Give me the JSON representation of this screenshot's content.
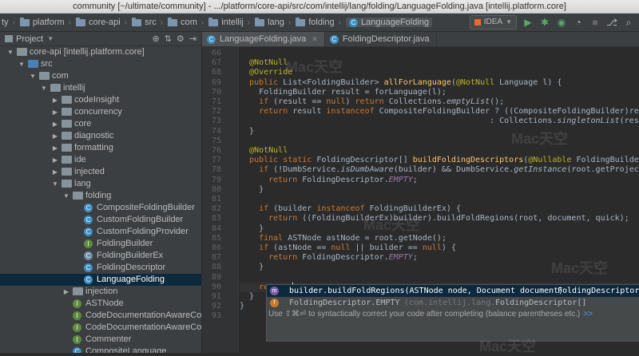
{
  "window": {
    "title": "community [~/ultimate/community] - .../platform/core-api/src/com/intellij/lang/folding/LanguageFolding.java [intellij.platform.core]"
  },
  "breadcrumbs": [
    {
      "label": "ty"
    },
    {
      "label": "platform"
    },
    {
      "label": "core-api"
    },
    {
      "label": "src"
    },
    {
      "label": "com"
    },
    {
      "label": "intellij"
    },
    {
      "label": "lang"
    },
    {
      "label": "folding"
    },
    {
      "label": "LanguageFolding"
    }
  ],
  "toolbar": {
    "run_config": "IDEA",
    "icons": [
      "run-icon",
      "debug-icon",
      "coverage-icon",
      "profile-icon",
      "stop-icon",
      "vcs-icon",
      "search-icon"
    ]
  },
  "project_panel": {
    "title": "Project",
    "tree": [
      {
        "label": "core-api [intellij.platform.core]",
        "depth": 0,
        "kind": "module",
        "expanded": true
      },
      {
        "label": "src",
        "depth": 1,
        "kind": "src",
        "expanded": true
      },
      {
        "label": "com",
        "depth": 2,
        "kind": "pkg",
        "expanded": true
      },
      {
        "label": "intellij",
        "depth": 3,
        "kind": "pkg",
        "expanded": true
      },
      {
        "label": "codeInsight",
        "depth": 4,
        "kind": "pkg",
        "expanded": false
      },
      {
        "label": "concurrency",
        "depth": 4,
        "kind": "pkg",
        "expanded": false
      },
      {
        "label": "core",
        "depth": 4,
        "kind": "pkg",
        "expanded": false
      },
      {
        "label": "diagnostic",
        "depth": 4,
        "kind": "pkg",
        "expanded": false
      },
      {
        "label": "formatting",
        "depth": 4,
        "kind": "pkg",
        "expanded": false
      },
      {
        "label": "ide",
        "depth": 4,
        "kind": "pkg",
        "expanded": false
      },
      {
        "label": "injected",
        "depth": 4,
        "kind": "pkg",
        "expanded": false
      },
      {
        "label": "lang",
        "depth": 4,
        "kind": "pkg",
        "expanded": true
      },
      {
        "label": "folding",
        "depth": 5,
        "kind": "pkg",
        "expanded": true
      },
      {
        "label": "CompositeFoldingBuilder",
        "depth": 6,
        "kind": "class",
        "glyph": "C"
      },
      {
        "label": "CustomFoldingBuilder",
        "depth": 6,
        "kind": "class",
        "glyph": "C"
      },
      {
        "label": "CustomFoldingProvider",
        "depth": 6,
        "kind": "class",
        "glyph": "C"
      },
      {
        "label": "FoldingBuilder",
        "depth": 6,
        "kind": "interface",
        "glyph": "I"
      },
      {
        "label": "FoldingBuilderEx",
        "depth": 6,
        "kind": "abstract",
        "glyph": "C"
      },
      {
        "label": "FoldingDescriptor",
        "depth": 6,
        "kind": "class",
        "glyph": "C"
      },
      {
        "label": "LanguageFolding",
        "depth": 6,
        "kind": "class",
        "glyph": "C",
        "selected": true
      },
      {
        "label": "injection",
        "depth": 5,
        "kind": "pkg",
        "expanded": false
      },
      {
        "label": "ASTNode",
        "depth": 5,
        "kind": "interface",
        "glyph": "I"
      },
      {
        "label": "CodeDocumentationAwareCo",
        "depth": 5,
        "kind": "interface",
        "glyph": "I"
      },
      {
        "label": "CodeDocumentationAwareCo",
        "depth": 5,
        "kind": "interface",
        "glyph": "I"
      },
      {
        "label": "Commenter",
        "depth": 5,
        "kind": "interface",
        "glyph": "I"
      },
      {
        "label": "CompositeLanguage",
        "depth": 5,
        "kind": "class",
        "glyph": "C"
      }
    ]
  },
  "editor": {
    "tabs": [
      {
        "label": "LanguageFolding.java",
        "active": true
      },
      {
        "label": "FoldingDescriptor.java",
        "active": false
      }
    ],
    "line_numbers": [
      "66",
      "67",
      "68",
      "69",
      "70",
      "71",
      "72",
      "73",
      "74",
      "75",
      "76",
      "77",
      "78",
      "79",
      "80",
      "81",
      "82",
      "83",
      "84",
      "85",
      "86",
      "87",
      "88",
      "89",
      "90",
      "91",
      "92",
      "93"
    ],
    "current_line": "90",
    "code_lines": [
      [],
      [
        {
          "t": "  "
        },
        {
          "t": "@NotNull",
          "c": "an"
        }
      ],
      [
        {
          "t": "  "
        },
        {
          "t": "@Override",
          "c": "an"
        }
      ],
      [
        {
          "t": "  "
        },
        {
          "t": "public ",
          "c": "kw"
        },
        {
          "t": "List<FoldingBuilder> "
        },
        {
          "t": "allForLanguage",
          "c": "fn"
        },
        {
          "t": "("
        },
        {
          "t": "@NotNull ",
          "c": "an"
        },
        {
          "t": "Language l) {"
        }
      ],
      [
        {
          "t": "    FoldingBuilder result = forLanguage(l);"
        }
      ],
      [
        {
          "t": "    "
        },
        {
          "t": "if ",
          "c": "kw"
        },
        {
          "t": "(result == "
        },
        {
          "t": "null",
          "c": "kw"
        },
        {
          "t": ") "
        },
        {
          "t": "return ",
          "c": "kw"
        },
        {
          "t": "Collections."
        },
        {
          "t": "emptyList",
          "c": "st"
        },
        {
          "t": "();"
        }
      ],
      [
        {
          "t": "    "
        },
        {
          "t": "return ",
          "c": "kw"
        },
        {
          "t": "result "
        },
        {
          "t": "instanceof ",
          "c": "kw"
        },
        {
          "t": "CompositeFoldingBuilder ? ((CompositeFoldingBuilder)result).getAllBuilders()"
        }
      ],
      [
        {
          "t": "                                                    : Collections."
        },
        {
          "t": "singletonList",
          "c": "st"
        },
        {
          "t": "(result);"
        }
      ],
      [
        {
          "t": "  }"
        }
      ],
      [],
      [
        {
          "t": "  "
        },
        {
          "t": "@NotNull",
          "c": "an"
        }
      ],
      [
        {
          "t": "  "
        },
        {
          "t": "public static ",
          "c": "kw"
        },
        {
          "t": "FoldingDescriptor[] "
        },
        {
          "t": "buildFoldingDescriptors",
          "c": "fn"
        },
        {
          "t": "("
        },
        {
          "t": "@Nullable ",
          "c": "an"
        },
        {
          "t": "FoldingBuilder builder, PsiElement root"
        }
      ],
      [
        {
          "t": "    "
        },
        {
          "t": "if ",
          "c": "kw"
        },
        {
          "t": "(!DumbService."
        },
        {
          "t": "isDumbAware",
          "c": "st"
        },
        {
          "t": "(builder) && DumbService."
        },
        {
          "t": "getInstance",
          "c": "st"
        },
        {
          "t": "(root.getProject()).isDumb()) {"
        }
      ],
      [
        {
          "t": "      "
        },
        {
          "t": "return ",
          "c": "kw"
        },
        {
          "t": "FoldingDescriptor."
        },
        {
          "t": "EMPTY",
          "c": "it"
        },
        {
          "t": ";"
        }
      ],
      [
        {
          "t": "    }"
        }
      ],
      [],
      [
        {
          "t": "    "
        },
        {
          "t": "if ",
          "c": "kw"
        },
        {
          "t": "(builder "
        },
        {
          "t": "instanceof ",
          "c": "kw"
        },
        {
          "t": "FoldingBuilderEx) {"
        }
      ],
      [
        {
          "t": "      "
        },
        {
          "t": "return ",
          "c": "kw"
        },
        {
          "t": "((FoldingBuilderEx)builder).buildFoldRegions(root, document, quick);"
        }
      ],
      [
        {
          "t": "    }"
        }
      ],
      [
        {
          "t": "    "
        },
        {
          "t": "final ",
          "c": "kw"
        },
        {
          "t": "ASTNode astNode = root.getNode();"
        }
      ],
      [
        {
          "t": "    "
        },
        {
          "t": "if ",
          "c": "kw"
        },
        {
          "t": "(astNode == "
        },
        {
          "t": "null ",
          "c": "kw"
        },
        {
          "t": "|| builder == "
        },
        {
          "t": "null",
          "c": "kw"
        },
        {
          "t": ") {"
        }
      ],
      [
        {
          "t": "      "
        },
        {
          "t": "return ",
          "c": "kw"
        },
        {
          "t": "FoldingDescriptor."
        },
        {
          "t": "EMPTY",
          "c": "it"
        },
        {
          "t": ";"
        }
      ],
      [
        {
          "t": "    }"
        }
      ],
      [],
      [
        {
          "t": "    "
        },
        {
          "t": "return ",
          "c": "kw"
        },
        {
          "t": "|",
          "c": "caret"
        }
      ],
      [
        {
          "t": "  }"
        }
      ],
      [
        {
          "t": "}"
        }
      ],
      []
    ]
  },
  "completion": {
    "items": [
      {
        "icon": "m",
        "text": "builder.buildFoldRegions(ASTNode node, Document document)",
        "type": "FoldingDescriptor[]",
        "selected": true
      },
      {
        "icon": "f",
        "text": "FoldingDescriptor.EMPTY",
        "grey": "(com.intellij.lang...",
        "type": "FoldingDescriptor[]",
        "selected": false
      }
    ],
    "hint": "Use ⇧⌘⏎ to syntactically correct your code after completing (balance parentheses etc.)",
    "hint_link": ">>"
  },
  "colors": {
    "editor_bg": "#2b2b2b",
    "panel_bg": "#3c3f41",
    "selection": "#0d293e",
    "keyword": "#cc7832",
    "annotation": "#bbb529",
    "method": "#ffc66d",
    "static_field": "#9876aa",
    "link": "#589df6"
  }
}
